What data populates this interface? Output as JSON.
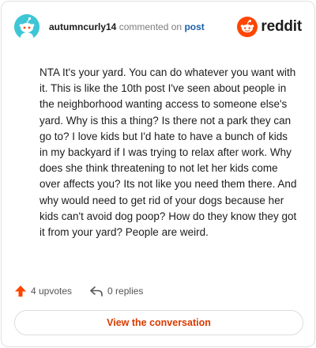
{
  "header": {
    "author": "autumncurly14",
    "commented_on_text": "commented on",
    "post_link": "post",
    "brand": "reddit"
  },
  "comment": {
    "body": "NTA It's your yard. You can do whatever you want with it. This is like the 10th post I've seen about people in the neighborhood wanting access to someone else's yard. Why is this a thing? Is there not a park they can go to? I love kids but I'd hate to have a bunch of kids in my backyard if I was trying to relax after work. Why does she think threatening to not let her kids come over affects you? Its not like you need them there. And why would need to get rid of your dogs because her kids can't avoid dog poop? How do they know they got it from your yard? People are weird."
  },
  "footer": {
    "upvotes": "4 upvotes",
    "replies": "0 replies"
  },
  "actions": {
    "view_conversation": "View the conversation"
  },
  "colors": {
    "brand_orange": "#ff4500",
    "accent_text": "#d93a00",
    "avatar_bg": "#3ec6d6",
    "link_blue": "#1c5fa8"
  },
  "icons": {
    "upvote": "upvote-arrow-icon",
    "reply": "reply-arrow-icon",
    "brand": "reddit-snoo-icon",
    "avatar": "snoo-avatar-icon"
  }
}
